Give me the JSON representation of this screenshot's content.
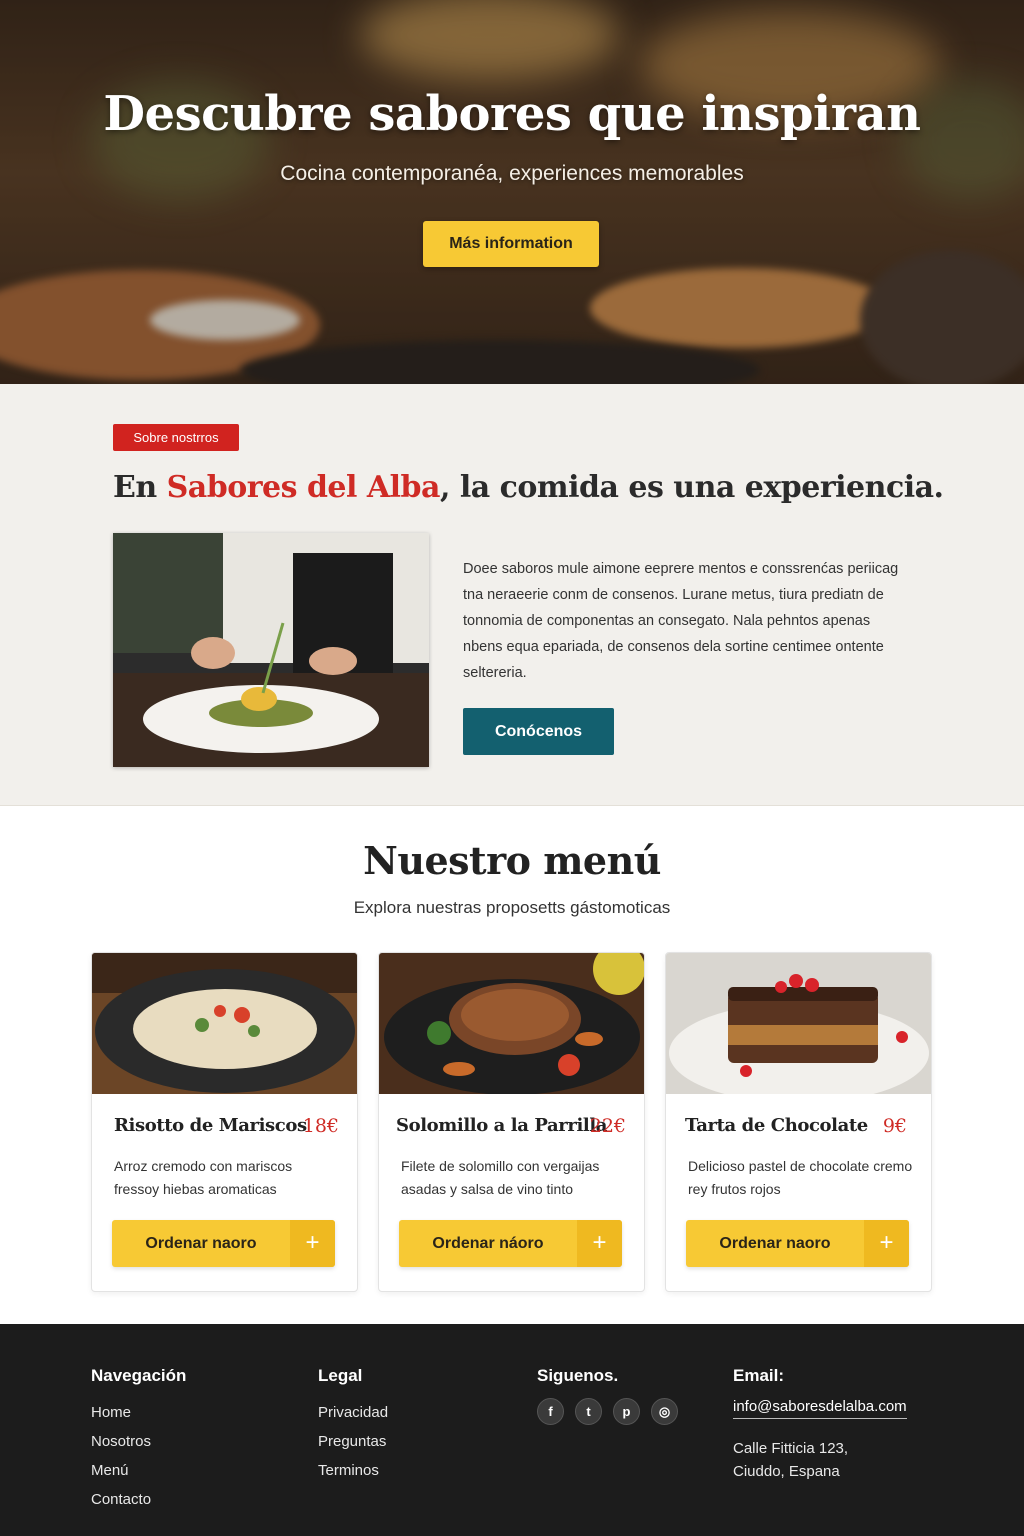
{
  "hero": {
    "title": "Descubre sabores que inspiran",
    "subtitle": "Cocina contemporanéa, experiences memorables",
    "cta_label": "Más information"
  },
  "about": {
    "badge": "Sobre nostrros",
    "title_prefix": "En ",
    "title_brand": "Sabores del Alba",
    "title_suffix": ", la comida es una experiencia.",
    "paragraph": "Doee saboros mule aimone eeprere mentos e conssrenćas periicag tna neraeerie conm de consenos. Lurane metus, tiura prediatn de tonnomia de componentas an consegato. Nala pehntos apenas nbens equa epariada, de consenos dela sortine centimee ontente seltereria.",
    "cta_label": "Conócenos"
  },
  "menu": {
    "title": "Nuestro menú",
    "subtitle": "Explora nuestras proposetts gástomoticas",
    "items": [
      {
        "name": "Risotto de Mariscos",
        "price": "18€",
        "description": "Arroz cremodo con mariscos fressoy hiebas aromaticas",
        "order_label": "Ordenar naoro",
        "plus": "+"
      },
      {
        "name": "Solomillo a la Parrilla",
        "price": "22€",
        "description": "Filete de solomillo con vergaijas asadas y salsa de vino tinto",
        "order_label": "Ordenar náoro",
        "plus": "+"
      },
      {
        "name": "Tarta de Chocolate",
        "price": "9€",
        "description": "Delicioso pastel de chocolate cremo rey frutos rojos",
        "order_label": "Ordenar naoro",
        "plus": "+"
      }
    ]
  },
  "footer": {
    "nav_heading": "Navegación",
    "nav_links": [
      "Home",
      "Nosotros",
      "Menú",
      "Contacto"
    ],
    "legal_heading": "Legal",
    "legal_links": [
      "Privacidad",
      "Preguntas",
      "Terminos"
    ],
    "social_heading": "Siguenos.",
    "social_icons": [
      "facebook-icon",
      "twitter-icon",
      "pinterest-icon",
      "instagram-icon"
    ],
    "social_glyphs": [
      "f",
      "t",
      "p",
      "◎"
    ],
    "email_heading": "Email:",
    "email": "info@saboresdelalba.com",
    "address_line1": "Calle Fitticia 123,",
    "address_line2": "Ciuddo, Espana"
  },
  "colors": {
    "accent_yellow": "#f7c934",
    "brand_red": "#cf2b25",
    "teal_button": "#13606f",
    "footer_bg": "#1c1c1c"
  }
}
